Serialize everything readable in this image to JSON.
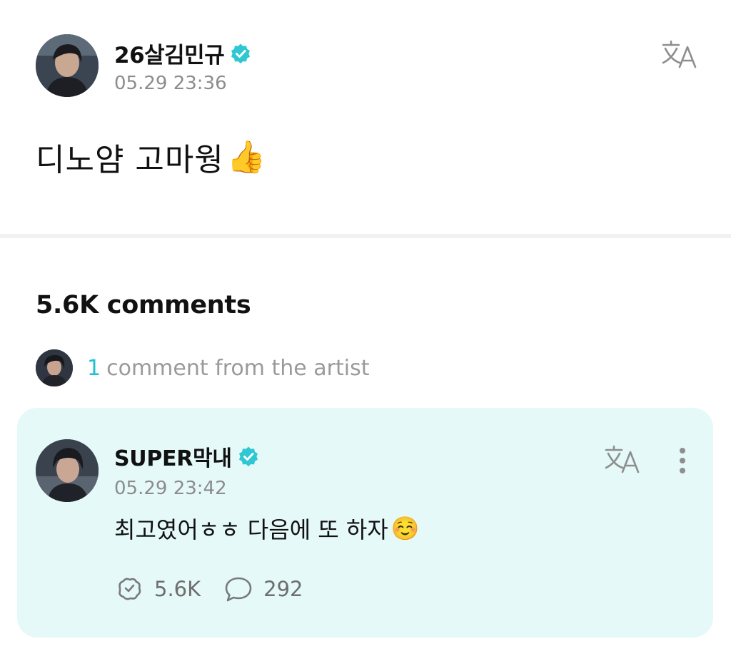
{
  "post": {
    "author": "26살김민규",
    "timestamp": "05.29 23:36",
    "text": "디노얌 고마웡",
    "emoji": "👍"
  },
  "comments_header": {
    "count_label": "5.6K comments",
    "artist_count": "1",
    "artist_label": "comment from the artist"
  },
  "comment": {
    "author": "SUPER막내",
    "timestamp": "05.29 23:42",
    "text": "최고였어ㅎㅎ 다음에 또 하자",
    "emoji": "☺️",
    "likes": "5.6K",
    "replies": "292"
  },
  "icons": {
    "verified": "verified-badge-icon",
    "translate": "translate-icon",
    "more": "more-vertical-icon",
    "like": "like-icon",
    "reply": "comment-bubble-icon"
  },
  "colors": {
    "accent": "#1ec1cf",
    "card_background": "#e4f9f8",
    "muted_text": "#8c8c8c"
  }
}
